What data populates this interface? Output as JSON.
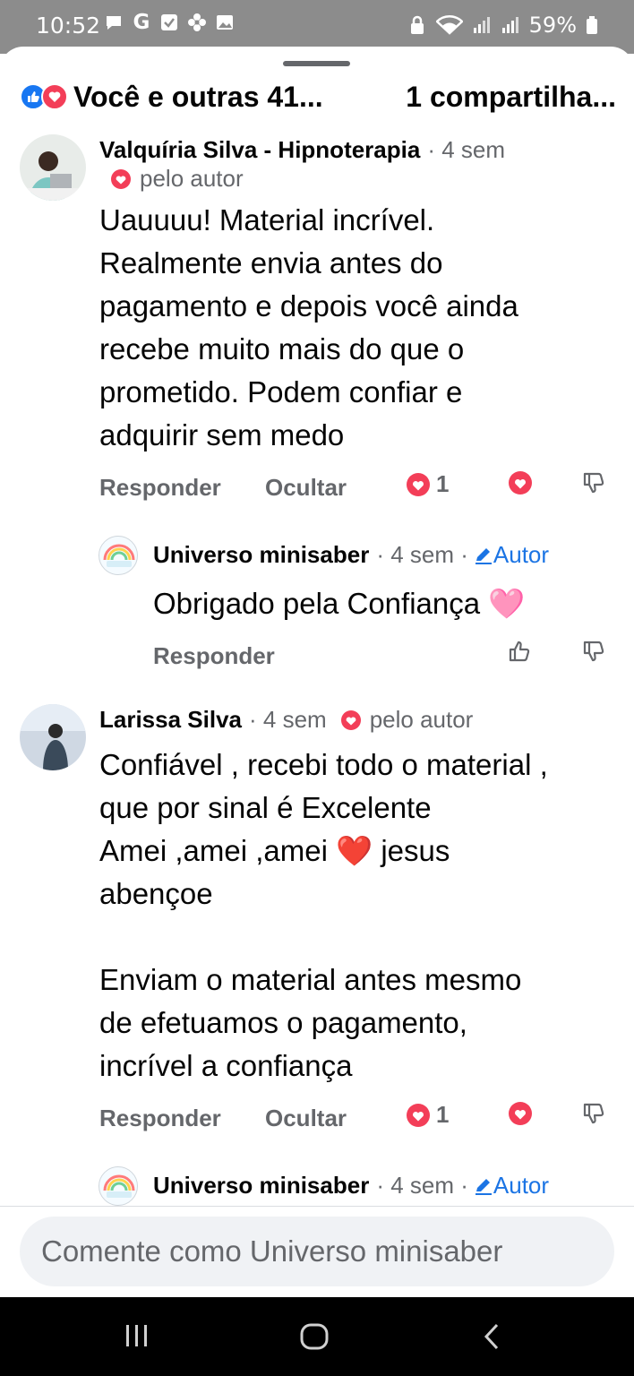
{
  "status_bar": {
    "time": "10:52",
    "battery": "59%",
    "left_icons": [
      "chat-icon",
      "google-icon",
      "check-icon",
      "flower-icon",
      "image-icon"
    ],
    "right_icons": [
      "lock-icon",
      "wifi-icon",
      "signal-icon",
      "signal-icon",
      "battery-icon"
    ]
  },
  "header": {
    "reactions_text": "Você e outras 41...",
    "shares_text": "1 compartilha..."
  },
  "comments": [
    {
      "author": "Valquíria Silva - Hipnoterapia",
      "time": "· 4 sem",
      "by_author": "pelo autor",
      "lines": [
        "Uauuuu! Material incrível.",
        "Realmente envia antes do",
        "pagamento e depois você ainda",
        "recebe muito mais do que o",
        "prometido. Podem confiar e",
        "adquirir sem medo"
      ],
      "reply_label": "Responder",
      "hide_label": "Ocultar",
      "reaction_count": "1",
      "reply": {
        "author": "Universo minisaber",
        "time": "· 4 sem ·",
        "badge": "Autor",
        "text": "Obrigado pela Confiança 🩷",
        "reply_label": "Responder"
      }
    },
    {
      "author": "Larissa Silva",
      "time": "· 4 sem",
      "by_author": "pelo autor",
      "lines": [
        "Confiável , recebi todo o material ,",
        "que por sinal é Excelente",
        "Amei ,amei ,amei ❤️ jesus",
        "abençoe",
        "",
        "Enviam o material antes mesmo",
        "de efetuamos o pagamento,",
        "incrível a confiança"
      ],
      "reply_label": "Responder",
      "hide_label": "Ocultar",
      "reaction_count": "1",
      "reply": {
        "author": "Universo minisaber",
        "time": "· 4 sem ·",
        "badge": "Autor"
      }
    }
  ],
  "composer": {
    "placeholder": "Comente como Universo minisaber"
  },
  "colors": {
    "accent": "#1b74e4",
    "love": "#f33e58",
    "muted": "#65676b"
  }
}
